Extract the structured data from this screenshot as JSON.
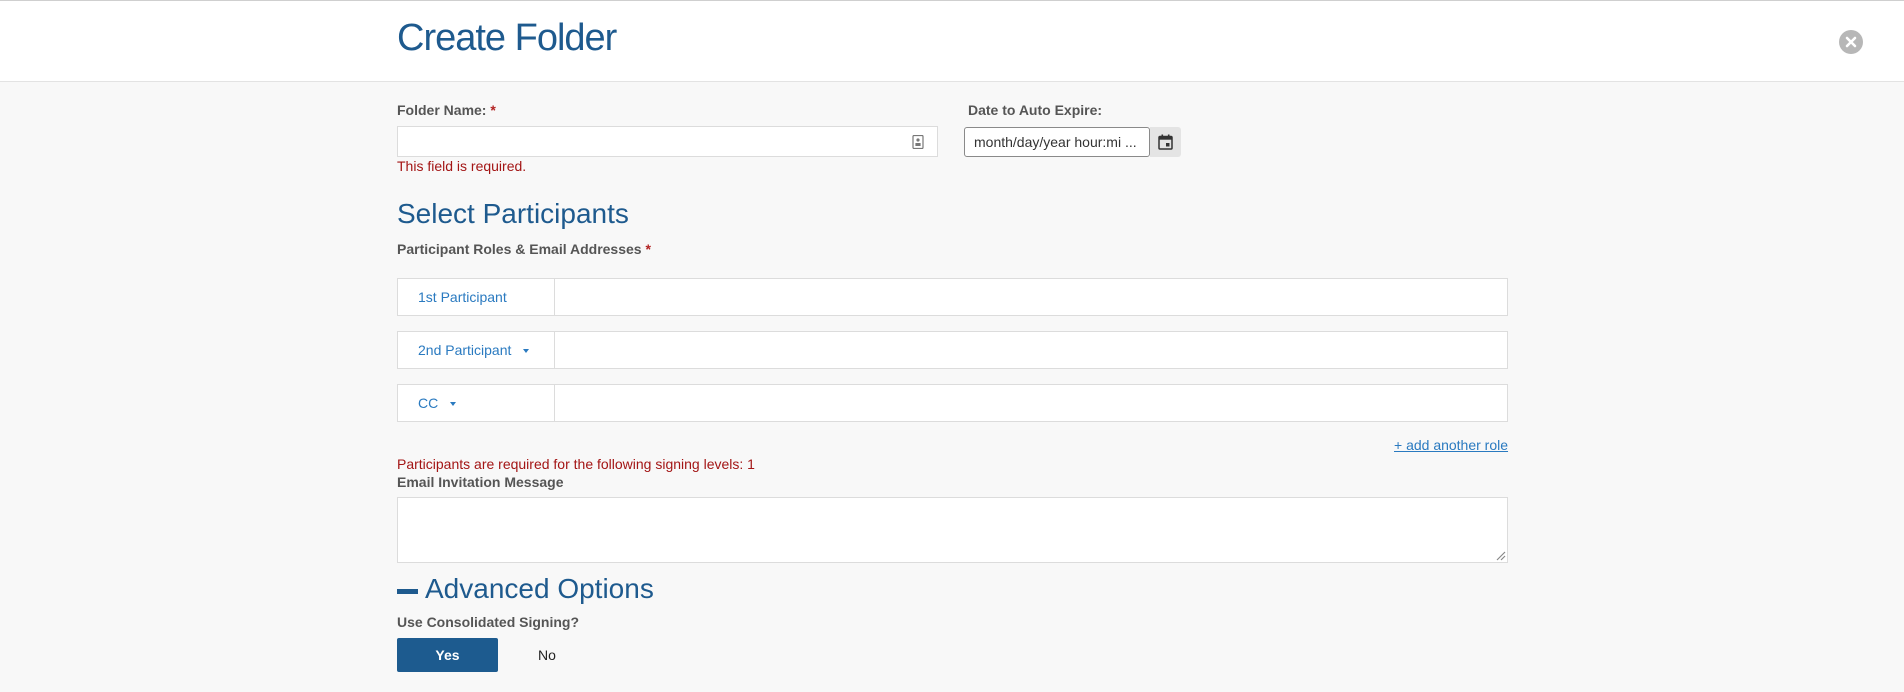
{
  "header": {
    "title": "Create Folder"
  },
  "form": {
    "folder_name": {
      "label": "Folder Name:",
      "required_mark": "*",
      "value": "",
      "error": "This field is required."
    },
    "auto_expire": {
      "label": "Date to Auto Expire:",
      "placeholder": "month/day/year hour:mi ..."
    }
  },
  "participants": {
    "title": "Select Participants",
    "label": "Participant Roles & Email Addresses",
    "required_mark": "*",
    "rows": [
      {
        "role": "1st Participant",
        "has_dropdown": false,
        "email": ""
      },
      {
        "role": "2nd Participant",
        "has_dropdown": true,
        "email": ""
      },
      {
        "role": "CC",
        "has_dropdown": true,
        "email": ""
      }
    ],
    "add_role_link": "+ add another role",
    "error": "Participants are required for the following signing levels: 1"
  },
  "email_message": {
    "label": "Email Invitation Message",
    "value": ""
  },
  "advanced": {
    "title": "Advanced Options",
    "consolidated_label": "Use Consolidated Signing?",
    "yes_label": "Yes",
    "no_label": "No",
    "selected": "Yes"
  },
  "icons": {
    "close": "close-circle-icon",
    "field": "contact-card-icon",
    "calendar": "calendar-icon",
    "collapse": "minus-icon",
    "resize": "resize-handle-icon"
  },
  "colors": {
    "title_blue": "#1e5a8e",
    "link_blue": "#2a7ac0",
    "error_red": "#a31515",
    "primary_button": "#1d5b8f"
  }
}
